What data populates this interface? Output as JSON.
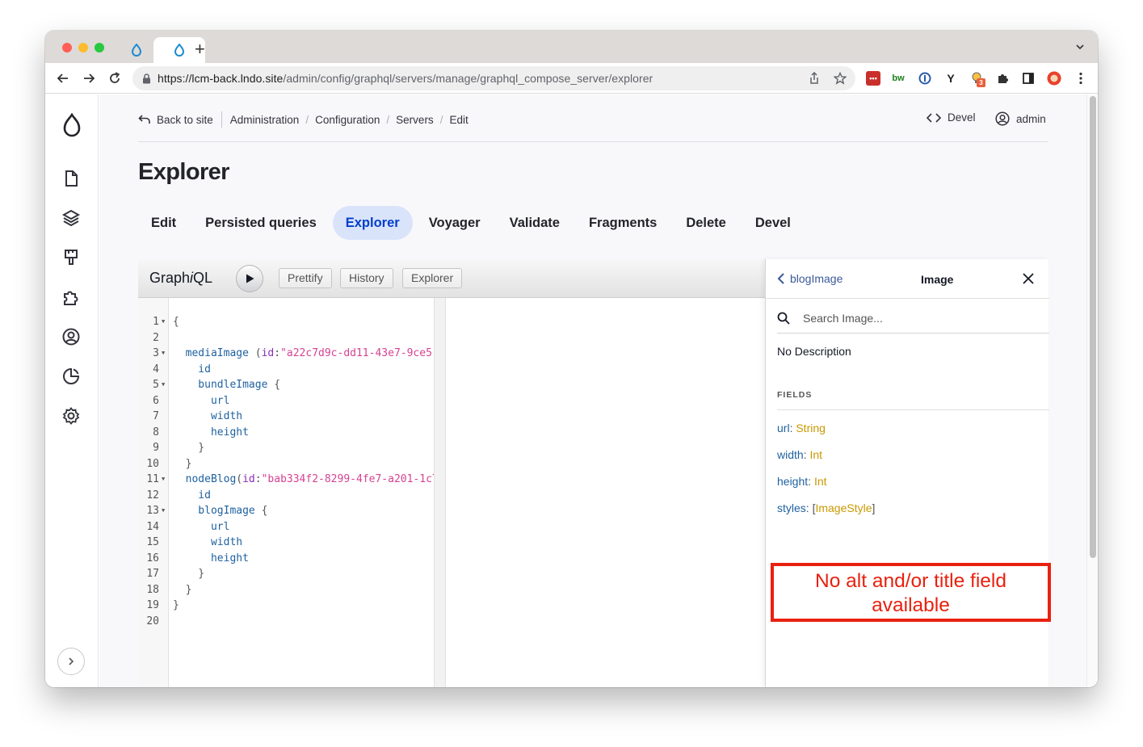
{
  "browser": {
    "url_host": "https://lcm-back.lndo.site",
    "url_path": "/admin/config/graphql/servers/manage/graphql_compose_server/explorer",
    "extension_badge": "3",
    "tab_new_label": "+"
  },
  "breadcrumbs": {
    "back_to_site": "Back to site",
    "items": [
      "Administration",
      "Configuration",
      "Servers",
      "Edit"
    ],
    "sep": "/"
  },
  "topbar": {
    "devel": "Devel",
    "user": "admin"
  },
  "page": {
    "title": "Explorer"
  },
  "local_tabs": [
    {
      "label": "Edit",
      "active": false
    },
    {
      "label": "Persisted queries",
      "active": false
    },
    {
      "label": "Explorer",
      "active": true
    },
    {
      "label": "Voyager",
      "active": false
    },
    {
      "label": "Validate",
      "active": false
    },
    {
      "label": "Fragments",
      "active": false
    },
    {
      "label": "Delete",
      "active": false
    },
    {
      "label": "Devel",
      "active": false
    }
  ],
  "graphiql": {
    "title_a": "Graph",
    "title_b": "i",
    "title_c": "QL",
    "buttons": [
      "Prettify",
      "History",
      "Explorer"
    ],
    "lines": [
      {
        "n": "1",
        "fold": true,
        "tokens": [
          [
            "punc",
            "{"
          ]
        ]
      },
      {
        "n": "2",
        "fold": false,
        "tokens": []
      },
      {
        "n": "3",
        "fold": true,
        "tokens": [
          [
            "kw",
            "  mediaImage"
          ],
          [
            "punc",
            " ("
          ],
          [
            "attr",
            "id"
          ],
          [
            "punc",
            ":"
          ],
          [
            "str",
            "\"a22c7d9c-dd11-43e7-9ce5-"
          ]
        ]
      },
      {
        "n": "4",
        "fold": false,
        "tokens": [
          [
            "kw",
            "    id"
          ]
        ]
      },
      {
        "n": "5",
        "fold": true,
        "tokens": [
          [
            "kw",
            "    bundleImage"
          ],
          [
            "punc",
            " {"
          ]
        ]
      },
      {
        "n": "6",
        "fold": false,
        "tokens": [
          [
            "kw",
            "      url"
          ]
        ]
      },
      {
        "n": "7",
        "fold": false,
        "tokens": [
          [
            "kw",
            "      width"
          ]
        ]
      },
      {
        "n": "8",
        "fold": false,
        "tokens": [
          [
            "kw",
            "      height"
          ]
        ]
      },
      {
        "n": "9",
        "fold": false,
        "tokens": [
          [
            "punc",
            "    }"
          ]
        ]
      },
      {
        "n": "10",
        "fold": false,
        "tokens": [
          [
            "punc",
            "  }"
          ]
        ]
      },
      {
        "n": "11",
        "fold": true,
        "tokens": [
          [
            "kw",
            "  nodeBlog"
          ],
          [
            "punc",
            "("
          ],
          [
            "attr",
            "id"
          ],
          [
            "punc",
            ":"
          ],
          [
            "str",
            "\"bab334f2-8299-4fe7-a201-1c7"
          ]
        ]
      },
      {
        "n": "12",
        "fold": false,
        "tokens": [
          [
            "kw",
            "    id"
          ]
        ]
      },
      {
        "n": "13",
        "fold": true,
        "tokens": [
          [
            "kw",
            "    blogImage"
          ],
          [
            "punc",
            " {"
          ]
        ]
      },
      {
        "n": "14",
        "fold": false,
        "tokens": [
          [
            "kw",
            "      url"
          ]
        ]
      },
      {
        "n": "15",
        "fold": false,
        "tokens": [
          [
            "kw",
            "      width"
          ]
        ]
      },
      {
        "n": "16",
        "fold": false,
        "tokens": [
          [
            "kw",
            "      height"
          ]
        ]
      },
      {
        "n": "17",
        "fold": false,
        "tokens": [
          [
            "punc",
            "    }"
          ]
        ]
      },
      {
        "n": "18",
        "fold": false,
        "tokens": [
          [
            "punc",
            "  }"
          ]
        ]
      },
      {
        "n": "19",
        "fold": false,
        "tokens": [
          [
            "punc",
            "}"
          ]
        ]
      },
      {
        "n": "20",
        "fold": false,
        "tokens": []
      }
    ]
  },
  "docs": {
    "back_label": "blogImage",
    "title": "Image",
    "search_placeholder": "Search Image...",
    "description": "No Description",
    "fields_title": "FIELDS",
    "fields": [
      {
        "name": "url",
        "type": "String",
        "list": false
      },
      {
        "name": "width",
        "type": "Int",
        "list": false
      },
      {
        "name": "height",
        "type": "Int",
        "list": false
      },
      {
        "name": "styles",
        "type": "ImageStyle",
        "list": true
      }
    ]
  },
  "annotation": {
    "line1": "No alt and/or title field",
    "line2": "available"
  },
  "colors": {
    "accent": "#003ecc",
    "tab_active_bg": "#d9e3fa",
    "annotation": "#e8210f"
  }
}
